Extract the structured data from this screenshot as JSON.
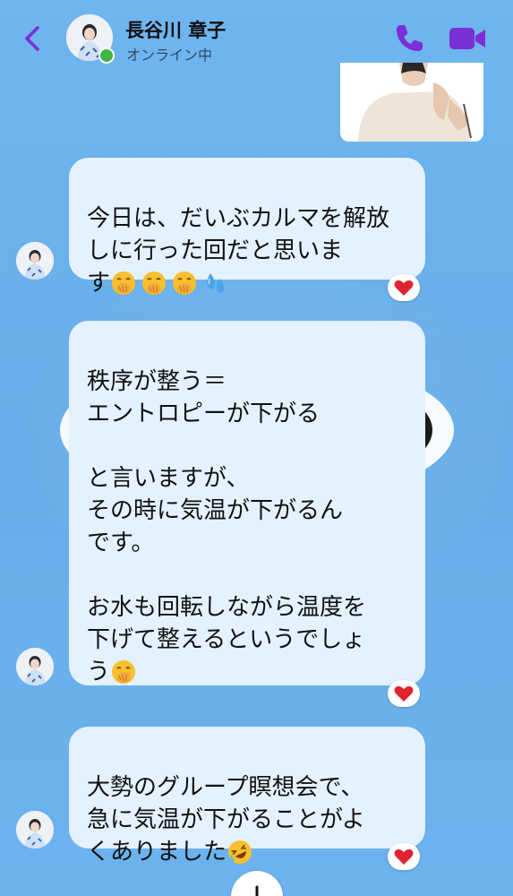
{
  "header": {
    "contact_name": "長谷川 章子",
    "contact_status": "オンライン中",
    "accent_color": "#7b2fd6",
    "online_color": "#3fb544"
  },
  "messages": [
    {
      "text": "今日は、だいぶカルマを解放しに行った回だと思いま\nす",
      "emojis": [
        "face-with-hand-over-mouth",
        "face-with-hand-over-mouth",
        "face-with-hand-over-mouth",
        "sweat-droplets"
      ],
      "reaction": "red-heart"
    },
    {
      "text": "秩序が整う＝\nエントロピーが下がる\n\nと言いますが、\nその時に気温が下がるん\nです。\n\nお水も回転しながら温度を\n下げて整えるというでしょ\nう",
      "emojis": [
        "face-with-hand-over-mouth"
      ],
      "reaction": "red-heart"
    },
    {
      "text": "大勢のグループ瞑想会で、\n急に気温が下がることがよ\nくありました",
      "emojis": [
        "rolling-on-the-floor-laughing"
      ],
      "reaction": "red-heart"
    }
  ],
  "colors": {
    "background": "#6cb2ee",
    "bubble": "#e4f1ff",
    "heart": "#e0242f"
  }
}
